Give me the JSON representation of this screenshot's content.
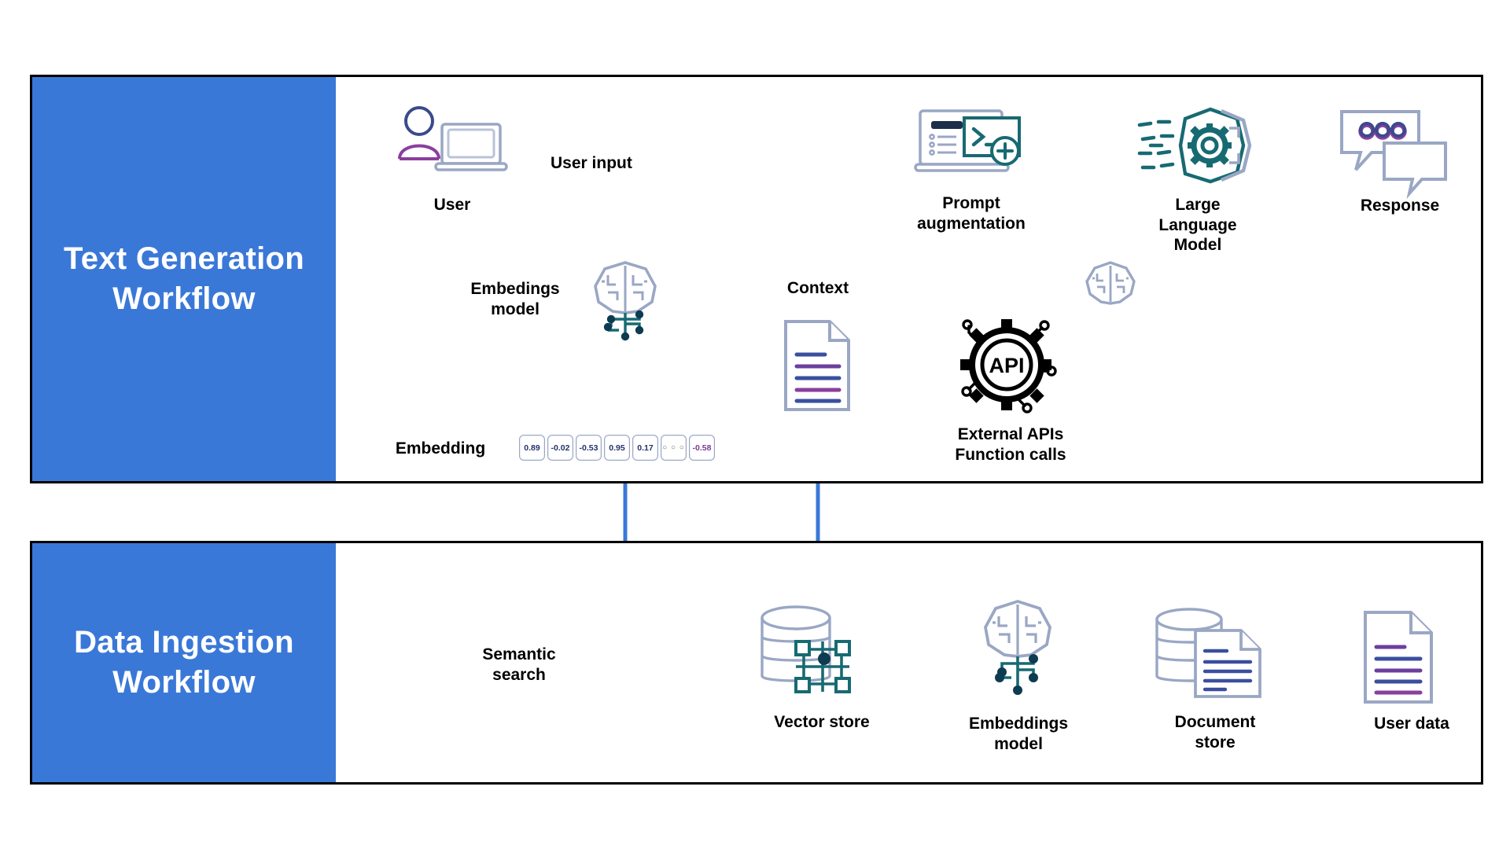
{
  "title": "RAG architecture: text generation and data ingestion workflows",
  "colors": {
    "band_blue": "#3a78d8",
    "arrow_blue": "#3a78d8",
    "teal": "#176a72",
    "ink": "#000000",
    "doc_line_a": "#2e4a9e",
    "doc_line_b": "#8a3f9e"
  },
  "panels": [
    {
      "id": "text-generation",
      "band_label": "Text\nGeneration\nWorkflow"
    },
    {
      "id": "data-ingestion",
      "band_label": "Data\nIngestion\nWorkflow"
    }
  ],
  "top_workflow": {
    "nodes": [
      {
        "id": "user",
        "label": "User",
        "icon": "user-laptop-icon"
      },
      {
        "id": "embeddings-model",
        "label": "Embedings\nmodel",
        "icon": "brain-circuit-icon"
      },
      {
        "id": "embedding",
        "label": "Embedding",
        "icon": "embedding-vector-icon"
      },
      {
        "id": "context",
        "label": "Context",
        "icon": "document-icon"
      },
      {
        "id": "prompt-augmentation",
        "label": "Prompt\naugmentation",
        "icon": "laptop-terminal-plus-icon"
      },
      {
        "id": "large-language-model",
        "label": "Large\nLanguage\nModel",
        "icon": "hexagon-brain-gear-icon"
      },
      {
        "id": "response",
        "label": "Response",
        "icon": "chat-bubbles-icon"
      },
      {
        "id": "external-apis",
        "label": "External APIs\nFunction calls",
        "icon": "api-gear-icon"
      },
      {
        "id": "llm-brain-relay",
        "label": "",
        "icon": "brain-icon"
      }
    ],
    "edges": [
      {
        "id": "user-input",
        "label": "User input",
        "from": "user",
        "to": "prompt-augmentation"
      },
      {
        "id": "user-to-embeddings",
        "label": "",
        "from": "user",
        "to": "embeddings-model"
      },
      {
        "id": "embeddings-to-vector",
        "label": "",
        "from": "embeddings-model",
        "to": "embedding"
      },
      {
        "id": "context-to-prompt",
        "label": "",
        "from": "context",
        "to": "prompt-augmentation"
      },
      {
        "id": "prompt-to-llm",
        "label": "",
        "from": "prompt-augmentation",
        "to": "large-language-model"
      },
      {
        "id": "llm-to-response",
        "label": "",
        "from": "large-language-model",
        "to": "response"
      },
      {
        "id": "prompt-to-brain-relay",
        "label": "",
        "from": "prompt-augmentation",
        "to": "llm-brain-relay"
      },
      {
        "id": "relay-to-apis",
        "label": "",
        "from": "llm-brain-relay",
        "to": "external-apis"
      },
      {
        "id": "apis-to-context",
        "label": "",
        "from": "external-apis",
        "to": "context"
      }
    ],
    "embedding_vector": [
      "0.89",
      "-0.02",
      "-0.53",
      "0.95",
      "0.17",
      "○ ○ ○",
      "-0.58"
    ]
  },
  "bottom_workflow": {
    "nodes": [
      {
        "id": "vector-store",
        "label": "Vector store",
        "icon": "database-grid-icon"
      },
      {
        "id": "embeddings-model",
        "label": "Embeddings\nmodel",
        "icon": "brain-circuit-icon"
      },
      {
        "id": "document-store",
        "label": "Document\nstore",
        "icon": "database-document-icon"
      },
      {
        "id": "user-data",
        "label": "User data",
        "icon": "document-icon"
      }
    ],
    "edges": [
      {
        "id": "userdata-to-docstore",
        "label": "",
        "from": "user-data",
        "to": "document-store"
      },
      {
        "id": "docstore-to-embeddings",
        "label": "",
        "from": "document-store",
        "to": "embeddings-model"
      },
      {
        "id": "embeddings-to-vector",
        "label": "",
        "from": "embeddings-model",
        "to": "vector-store"
      },
      {
        "id": "semantic-search",
        "label": "Semantic\nsearch",
        "from": "embedding",
        "to": "vector-store"
      },
      {
        "id": "vector-to-context",
        "label": "",
        "from": "vector-store",
        "to": "context"
      }
    ]
  }
}
